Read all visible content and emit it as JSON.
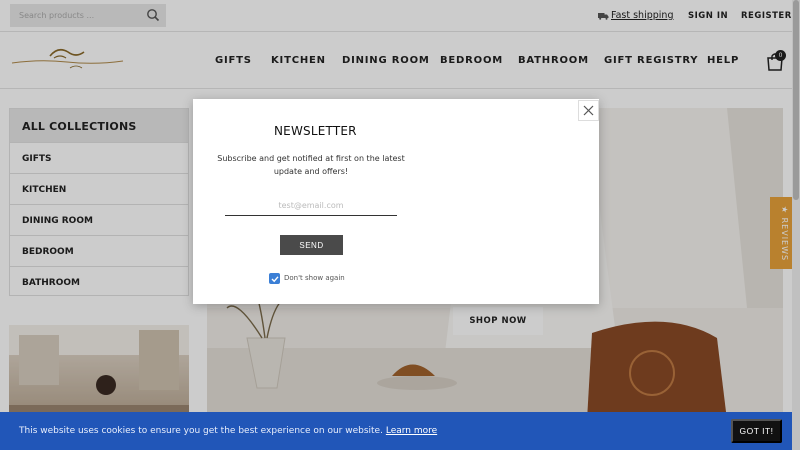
{
  "search": {
    "placeholder": "Search products ..."
  },
  "topbar": {
    "fast_shipping": "Fast shipping",
    "sign_in": "SIGN IN",
    "register": "REGISTER"
  },
  "nav": [
    "GIFTS",
    "KITCHEN",
    "DINING ROOM",
    "BEDROOM",
    "BATHROOM",
    "GIFT REGISTRY",
    "HELP"
  ],
  "cart": {
    "count": "0"
  },
  "sidebar": {
    "title": "ALL COLLECTIONS",
    "items": [
      "GIFTS",
      "KITCHEN",
      "DINING ROOM",
      "BEDROOM",
      "BATHROOM"
    ]
  },
  "hero": {
    "cta": "SHOP NOW"
  },
  "reviews": {
    "label": "★ REVIEWS"
  },
  "modal": {
    "title": "NEWSLETTER",
    "description": "Subscribe and get notified at first on the latest update and offers!",
    "email_placeholder": "test@email.com",
    "send_label": "SEND",
    "dont_show_label": "Don't show again",
    "dont_show_checked": true
  },
  "cookie": {
    "text": "This website uses cookies to ensure you get the best experience on our website.",
    "link": "Learn more",
    "button": "GOT IT!"
  },
  "colors": {
    "cookie_bg": "#2156b8",
    "reviews_bg": "#e8a23a",
    "checkbox": "#3b7fd6"
  }
}
